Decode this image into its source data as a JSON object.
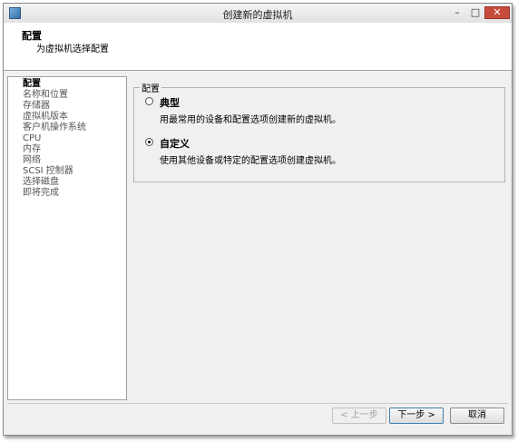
{
  "window": {
    "title": "创建新的虚拟机"
  },
  "header": {
    "title": "配置",
    "subtitle": "为虚拟机选择配置"
  },
  "nav": {
    "items": [
      {
        "label": "配置",
        "active": true
      },
      {
        "label": "名称和位置"
      },
      {
        "label": "存储器"
      },
      {
        "label": "虚拟机版本"
      },
      {
        "label": "客户机操作系统"
      },
      {
        "label": "CPU"
      },
      {
        "label": "内存"
      },
      {
        "label": "网络"
      },
      {
        "label": "SCSI 控制器"
      },
      {
        "label": "选择磁盘"
      },
      {
        "label": "即将完成"
      }
    ]
  },
  "config": {
    "legend": "配置",
    "options": [
      {
        "label": "典型",
        "description": "用最常用的设备和配置选项创建新的虚拟机。",
        "selected": false
      },
      {
        "label": "自定义",
        "description": "使用其他设备或特定的配置选项创建虚拟机。",
        "selected": true
      }
    ]
  },
  "buttons": {
    "back": "< 上一步",
    "next": "下一步 >",
    "cancel": "取消"
  }
}
